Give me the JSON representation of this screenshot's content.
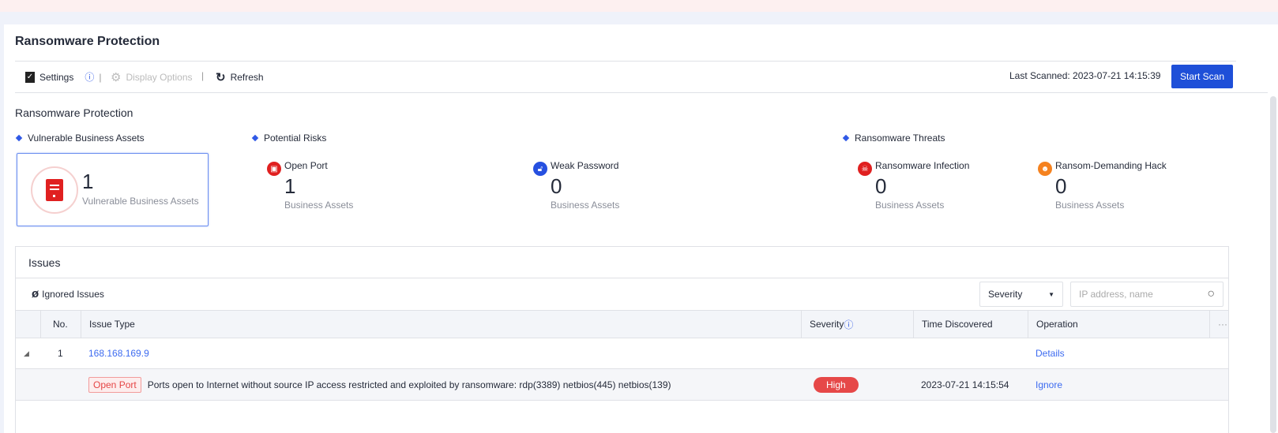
{
  "header": {
    "title": "Ransomware Protection"
  },
  "toolbar": {
    "settings": "Settings",
    "display_options": "Display Options",
    "refresh": "Refresh",
    "last_scanned": "Last Scanned: 2023-07-21 14:15:39",
    "start_scan": "Start Scan"
  },
  "overview": {
    "title": "Ransomware Protection",
    "vulnerable": {
      "heading": "Vulnerable Business Assets",
      "count": "1",
      "label": "Vulnerable Business Assets"
    },
    "potential_risks": {
      "heading": "Potential Risks",
      "items": [
        {
          "name": "Open Port",
          "count": "1",
          "unit": "Business Assets"
        },
        {
          "name": "Weak Password",
          "count": "0",
          "unit": "Business Assets"
        }
      ]
    },
    "threats": {
      "heading": "Ransomware Threats",
      "items": [
        {
          "name": "Ransomware Infection",
          "count": "0",
          "unit": "Business Assets"
        },
        {
          "name": "Ransom-Demanding Hack",
          "count": "0",
          "unit": "Business Assets"
        }
      ]
    }
  },
  "issues": {
    "title": "Issues",
    "ignored": "Ignored Issues",
    "severity_filter": "Severity",
    "search_placeholder": "IP address, name",
    "columns": {
      "no": "No.",
      "type": "Issue Type",
      "severity": "Severity",
      "time": "Time Discovered",
      "operation": "Operation"
    },
    "rows": [
      {
        "no": "1",
        "ip": "168.168.169.9",
        "op": "Details",
        "child": {
          "tag": "Open Port",
          "desc": "Ports open to Internet without source IP access restricted and exploited by ransomware: rdp(3389) netbios(445) netbios(139)",
          "severity": "High",
          "time": "2023-07-21 14:15:54",
          "op": "Ignore"
        }
      }
    ]
  }
}
